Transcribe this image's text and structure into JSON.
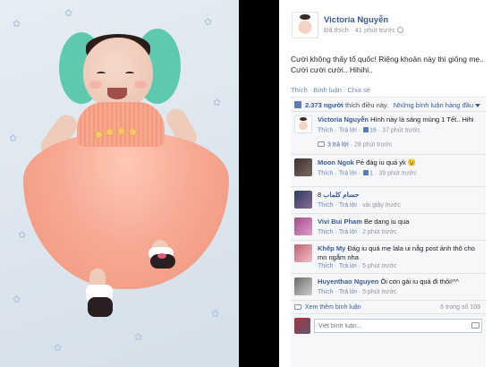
{
  "post": {
    "author": "Victoria Nguyễn",
    "meta": "Đã thích · 41 phút trước",
    "text": "Cười không thấy tổ quốc! Riêng khoản này thì giống mẹ.. Cười cười cười.. Hihihi..",
    "actions": [
      "Thích",
      "Bình luận",
      "Chia sẻ"
    ]
  },
  "likes": {
    "count": "2.373 người",
    "suffix": "thích điều này.",
    "sort_label": "Những bình luận hàng đầu"
  },
  "comments": [
    {
      "author": "Victoria Nguyễn",
      "text": "Hình này là sáng mùng 1 Tết.. Hihi",
      "actions": [
        "Thích",
        "Trả lời"
      ],
      "likes": "16",
      "time": "37 phút trước",
      "avatar": "baby",
      "reply": {
        "label": "3 trả lời",
        "time": "28 phút trước"
      }
    },
    {
      "author": "Moon Ngok",
      "text": "Pé đág iu quá yk 😉",
      "actions": [
        "Thích",
        "Trả lời"
      ],
      "likes": "1",
      "time": "39 phút trước",
      "avatar": "dark"
    },
    {
      "author": "حسام كلماب",
      "text": "8",
      "actions": [
        "Thích",
        "Trả lời"
      ],
      "time": "vài giây trước",
      "avatar": "purple"
    },
    {
      "author": "Vivi Bui Pham",
      "text": "Be dang iu qua",
      "actions": [
        "Thích",
        "Trả lời"
      ],
      "time": "2 phút trước",
      "avatar": "pink"
    },
    {
      "author": "Khếp My",
      "text": "Đág iu quá mẹ lala ui nắg post ảnh thô cho mn ngắm nha",
      "actions": [
        "Thích",
        "Trả lời"
      ],
      "time": "5 phút trước",
      "avatar": "rose"
    },
    {
      "author": "Huyenthao Nguyen",
      "text": "Ôi con gái iu quá đi thôi!^^",
      "actions": [
        "Thích",
        "Trả lời"
      ],
      "time": "5 phút trước",
      "avatar": "grey"
    }
  ],
  "more": {
    "label": "Xem thêm bình luận",
    "count": "6 trong số 109"
  },
  "composer": {
    "placeholder": "Viết bình luận..."
  },
  "colors": {
    "link": "#3b5998",
    "like_blue": "#5b7bbb",
    "ufi_bg": "#f6f7f9",
    "dress": "#f8a890",
    "pillow": "#5fc9ae"
  },
  "icons": [
    "globe-icon",
    "like-thumb-icon",
    "reply-arrow-icon",
    "camera-icon",
    "caret-down-icon"
  ]
}
